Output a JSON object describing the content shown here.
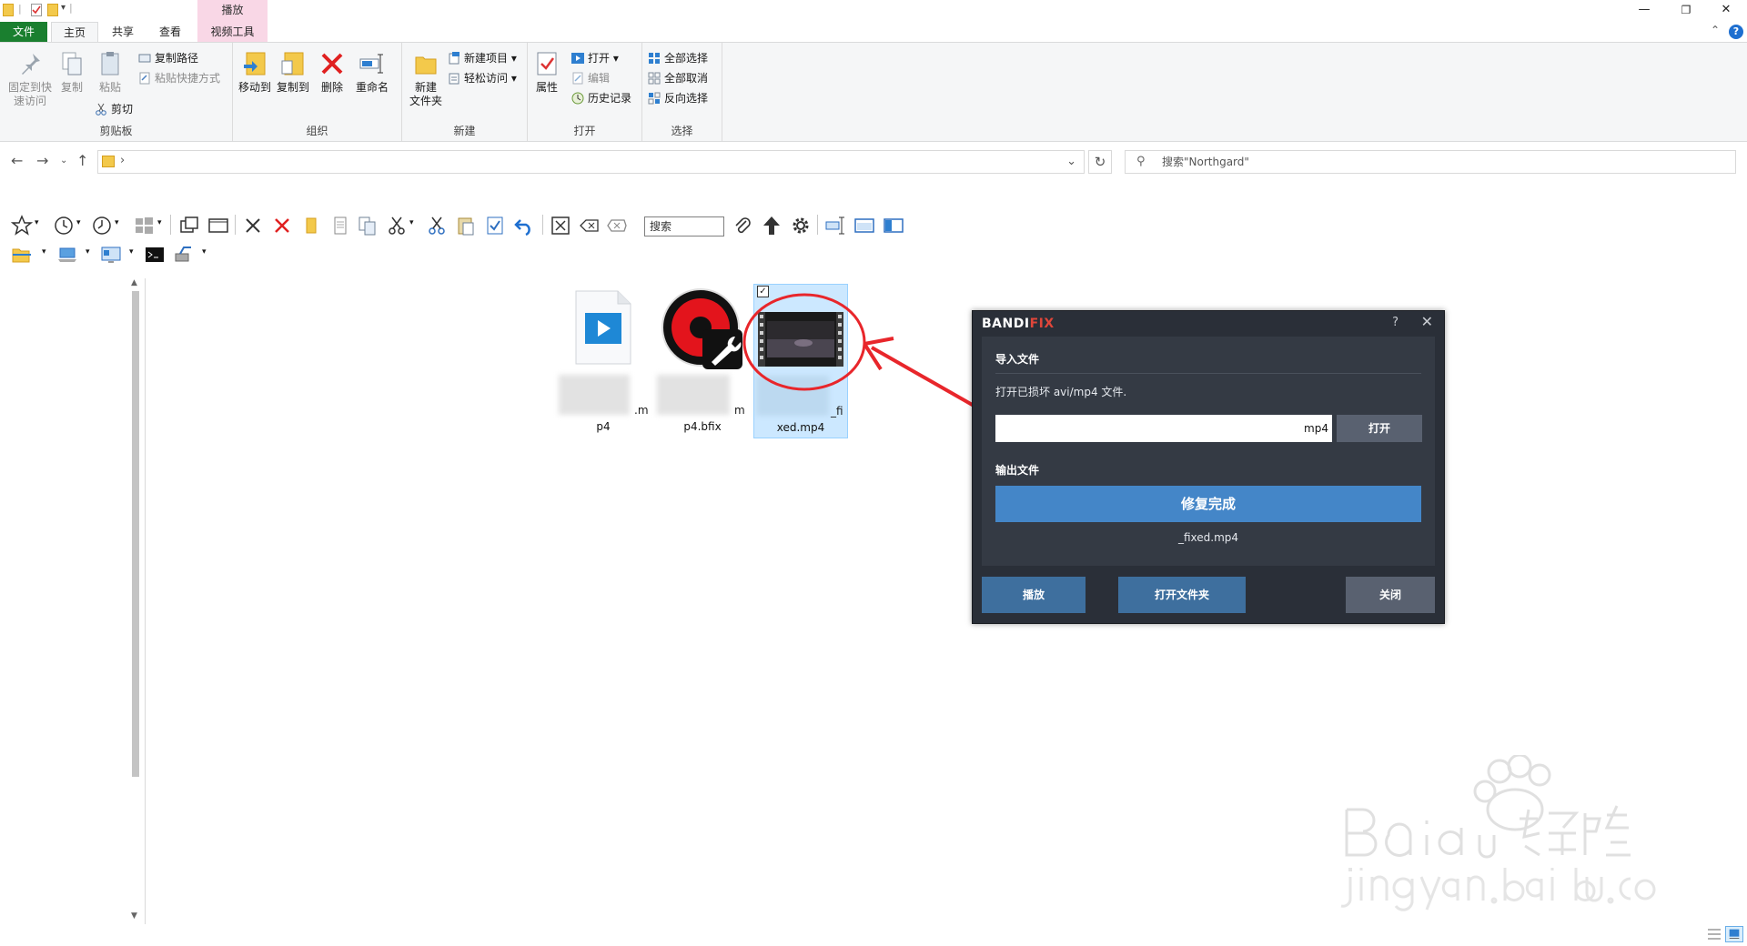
{
  "window": {
    "controls": {
      "minimize": "—",
      "restore": "❐",
      "close": "✕"
    }
  },
  "ribbon_tabs": {
    "file": "文件",
    "home": "主页",
    "share": "共享",
    "view": "查看",
    "context_group": "播放",
    "video_tools": "视频工具"
  },
  "ribbon": {
    "clipboard": {
      "label": "剪贴板",
      "pin_line1": "固定到快",
      "pin_line2": "速访问",
      "copy": "复制",
      "paste": "粘贴",
      "copy_path": "复制路径",
      "paste_shortcut": "粘贴快捷方式",
      "cut": "剪切"
    },
    "organize": {
      "label": "组织",
      "move_to": "移动到",
      "copy_to": "复制到",
      "delete": "删除",
      "rename": "重命名"
    },
    "new": {
      "label": "新建",
      "new_folder_line1": "新建",
      "new_folder_line2": "文件夹",
      "new_item": "新建项目",
      "easy_access": "轻松访问"
    },
    "open": {
      "label": "打开",
      "properties": "属性",
      "open": "打开",
      "edit": "编辑",
      "history": "历史记录"
    },
    "select": {
      "label": "选择",
      "select_all": "全部选择",
      "select_none": "全部取消",
      "invert": "反向选择"
    }
  },
  "addressbar": {
    "path_chevron": "›",
    "search_placeholder": "搜索\"Northgard\"",
    "refresh": "↻",
    "dropdown": "⌄"
  },
  "toolbar": {
    "search_label": "搜索"
  },
  "files": [
    {
      "name_suffix_line1": ".m",
      "name_line2": "p4",
      "icon": "video-file-icon"
    },
    {
      "name_suffix_line1": "m",
      "name_line2": "p4.bfix",
      "icon": "bandifix-file-icon"
    },
    {
      "name_suffix_line1": "_fi",
      "name_line2": "xed.mp4",
      "icon": "video-thumbnail-icon",
      "selected": true
    }
  ],
  "bandifix": {
    "title_a": "BANDI",
    "title_b": "FIX",
    "help": "?",
    "close": "✕",
    "import_header": "导入文件",
    "import_desc": "打开已损坏 avi/mp4 文件.",
    "input_value": "mp4",
    "open_button": "打开",
    "output_header": "输出文件",
    "done_button": "修复完成",
    "output_file": "_fixed.mp4",
    "play_button": "播放",
    "open_folder_button": "打开文件夹",
    "close_button": "关闭"
  },
  "colors": {
    "file_tab": "#1a7f2f",
    "context_tab": "#f9d7e6",
    "selection": "#cce8ff",
    "dialog_bg": "#2a2f38",
    "done_blue": "#4486c8",
    "annotation_red": "#e8262b"
  }
}
